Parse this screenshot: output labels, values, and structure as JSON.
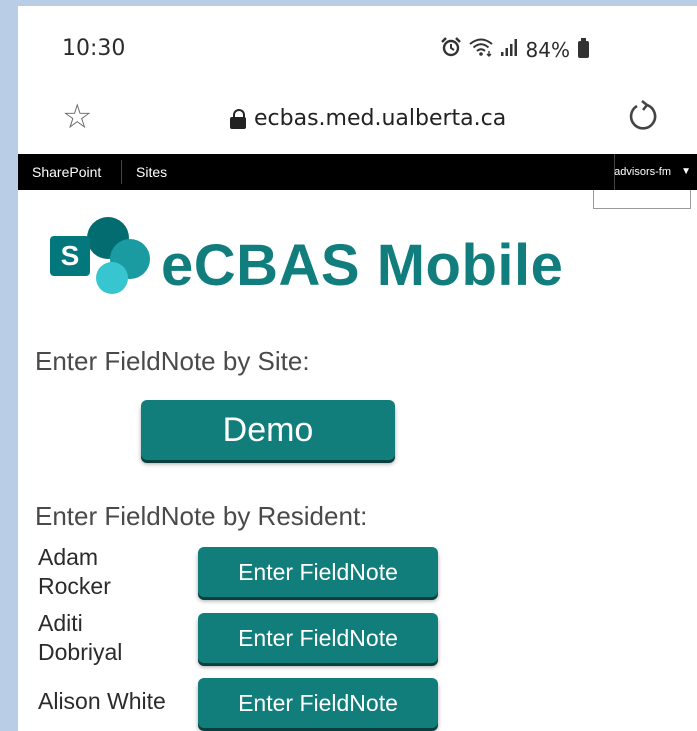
{
  "status_bar": {
    "time": "10:30",
    "battery": "84%",
    "icons": [
      "alarm-icon",
      "wifi-icon",
      "signal-icon",
      "battery-icon"
    ]
  },
  "browser": {
    "url": "ecbas.med.ualberta.ca",
    "icons": [
      "star-icon",
      "lock-icon",
      "reload-icon"
    ]
  },
  "sharepoint_bar": {
    "sharepoint_label": "SharePoint",
    "sites_label": "Sites",
    "user": "advisors-fm"
  },
  "app": {
    "title": "eCBAS Mobile",
    "logo_letter": "S",
    "brand_color": "#117d7c"
  },
  "by_site": {
    "label": "Enter FieldNote by Site:",
    "demo_button": "Demo"
  },
  "by_resident": {
    "label": "Enter FieldNote by Resident:",
    "residents": [
      {
        "name_line1": "Adam",
        "name_line2": "Rocker",
        "button": "Enter FieldNote"
      },
      {
        "name_line1": "Aditi",
        "name_line2": "Dobriyal",
        "button": "Enter FieldNote"
      },
      {
        "name_line1": "Alison White",
        "name_line2": "",
        "button": "Enter FieldNote"
      }
    ]
  }
}
